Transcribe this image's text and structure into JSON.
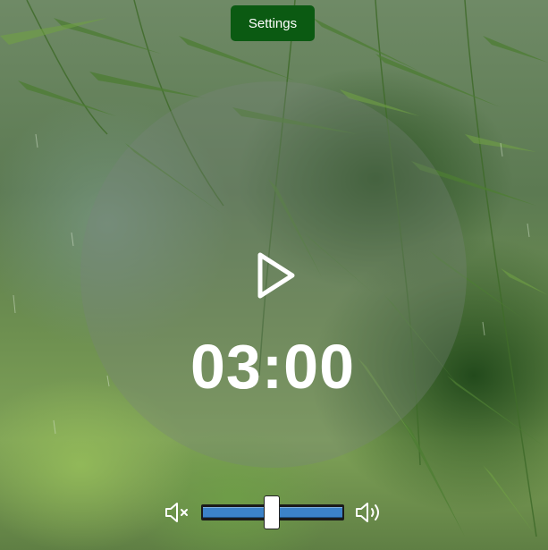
{
  "header": {
    "settings_label": "Settings"
  },
  "timer": {
    "time": "03:00",
    "play_icon": "play-icon"
  },
  "volume": {
    "mute_icon": "volume-mute-icon",
    "max_icon": "volume-up-icon",
    "level": 0.49
  },
  "colors": {
    "settings_bg": "#0b5a12",
    "slider_fill": "#3c82c8",
    "text": "#ffffff"
  }
}
